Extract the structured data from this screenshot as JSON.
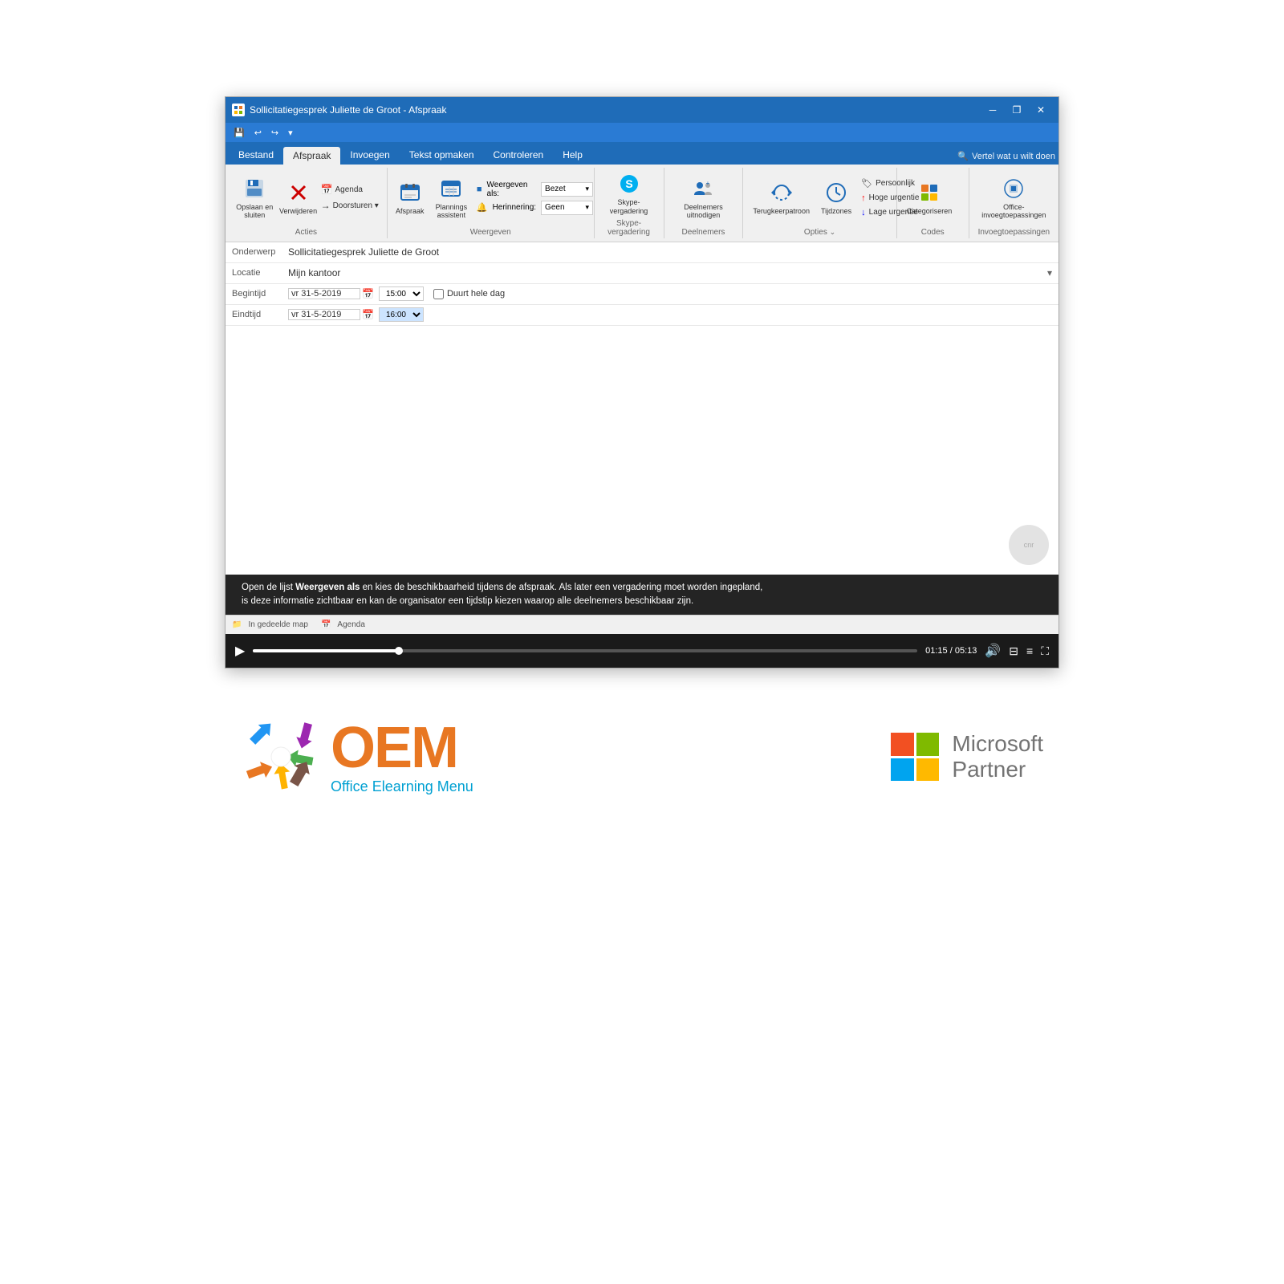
{
  "titlebar": {
    "title": "Sollicitatiegesprek Juliette de Groot - Afspraak",
    "minimize_label": "─",
    "restore_label": "❐",
    "close_label": "✕"
  },
  "qat": {
    "save_label": "💾",
    "undo_label": "↩",
    "redo_label": "↪",
    "dropdown_label": "▾"
  },
  "ribbon_tabs": {
    "bestand": "Bestand",
    "afspraak": "Afspraak",
    "invoegen": "Invoegen",
    "tekst_opmaken": "Tekst opmaken",
    "controleren": "Controleren",
    "help": "Help",
    "search_placeholder": "Vertel wat u wilt doen"
  },
  "ribbon_groups": {
    "acties": {
      "label": "Acties",
      "opslaan_label": "Opslaan\nen sluiten",
      "verwijderen_label": "Verwijderen",
      "agenda_label": "Agenda",
      "doorsturen_label": "Doorsturen ▾"
    },
    "weergeven": {
      "label": "Weergeven",
      "afspraak_label": "Afspraak",
      "planningsassistent_label": "Plannings\nassistent",
      "weergeven_als_label": "Weergeven als:",
      "weergeven_als_value": "Bezet",
      "herinnering_label": "Herinnering:",
      "herinnering_value": "Geen"
    },
    "skype": {
      "label": "Skype-vergadering",
      "skype_label": "Skype-\nvergadering"
    },
    "deelnemers": {
      "label": "Deelnemers",
      "uitnodigen_label": "Deelnemers\nuitnodigen"
    },
    "opties": {
      "label": "Opties",
      "terugkeerpatroon_label": "Terugkeerpatroon",
      "tijdzones_label": "Tijdzones",
      "persoonlijk_label": "Persoonlijk",
      "hoge_urgentie_label": "Hoge urgentie",
      "lage_urgentie_label": "Lage urgentie"
    },
    "codes": {
      "label": "Codes",
      "categoriseren_label": "Categoriseren"
    },
    "invoegtoepassingen": {
      "label": "Invoegtoepassingen",
      "office_label": "Office-\ninvoegtoepassingen"
    }
  },
  "form": {
    "onderwerp_label": "Onderwerp",
    "onderwerp_value": "Sollicitatiegesprek Juliette de Groot",
    "locatie_label": "Locatie",
    "locatie_value": "Mijn kantoor",
    "begintijd_label": "Begintijd",
    "begintijd_date": "vr 31-5-2019",
    "begintijd_time": "15:00",
    "duurt_hele_dag": "Duurt hele dag",
    "eindtijd_label": "Eindtijd",
    "eindtijd_date": "vr 31-5-2019",
    "eindtijd_time": "16:00"
  },
  "subtitle": {
    "text_normal": "Open de lijst ",
    "text_bold": "Weergeven als",
    "text_normal2": " en kies de beschikbaarheid tijdens de afspraak. Als later een vergadering moet worden ingepland,",
    "text_line2": "is deze informatie zichtbaar en kan de organisator een tijdstip kiezen waarop alle deelnemers beschikbaar zijn."
  },
  "statusbar": {
    "gedeelde_map": "In gedeelde map",
    "agenda_label": "Agenda"
  },
  "video_controls": {
    "play_icon": "▶",
    "time_current": "01:15",
    "time_total": "05:13",
    "volume_icon": "🔊",
    "captions_icon": "⊟",
    "chapters_icon": "≡",
    "fullscreen_icon": "⛶",
    "progress_percent": 22
  },
  "oem_logo": {
    "main_text": "OEM",
    "sub_text": "Office Elearning Menu"
  },
  "ms_partner": {
    "microsoft_text": "Microsoft",
    "partner_text": "Partner"
  }
}
